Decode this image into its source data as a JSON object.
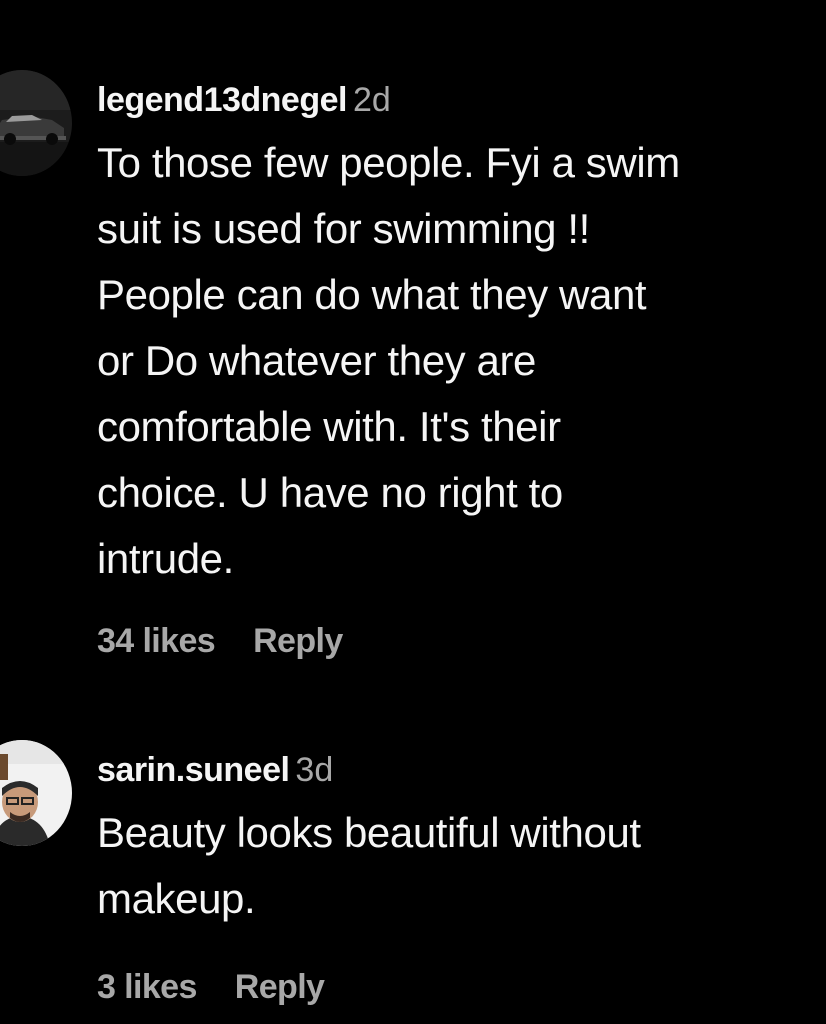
{
  "comments": [
    {
      "username": "legend13dnegel",
      "time": "2d",
      "lines": [
        "To those few people. Fyi a swim",
        "suit is used for swimming !!",
        "People can do what they want",
        "or Do whatever they are",
        "comfortable with. It's their",
        "choice. U have no right to",
        "intrude."
      ],
      "likes": "34 likes",
      "reply": "Reply",
      "avatar_icon": "car-avatar-icon"
    },
    {
      "username": "sarin.suneel",
      "time": "3d",
      "lines": [
        "Beauty looks beautiful without",
        "makeup."
      ],
      "likes": "3 likes",
      "reply": "Reply",
      "avatar_icon": "person-avatar-icon"
    }
  ],
  "colors": {
    "background": "#000000",
    "primary_text": "#f5f5f5",
    "secondary_text": "#a8a8a8"
  }
}
